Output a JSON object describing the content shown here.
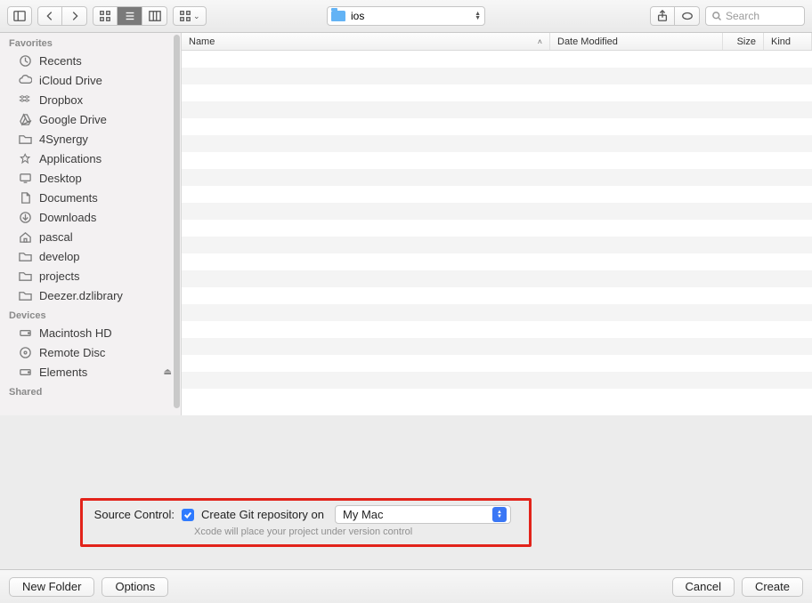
{
  "toolbar": {
    "path_label": "ios",
    "search_placeholder": "Search"
  },
  "sidebar": {
    "sections": [
      {
        "heading": "Favorites",
        "items": [
          "Recents",
          "iCloud Drive",
          "Dropbox",
          "Google Drive",
          "4Synergy",
          "Applications",
          "Desktop",
          "Documents",
          "Downloads",
          "pascal",
          "develop",
          "projects",
          "Deezer.dzlibrary"
        ]
      },
      {
        "heading": "Devices",
        "items": [
          "Macintosh HD",
          "Remote Disc",
          "Elements"
        ]
      },
      {
        "heading": "Shared",
        "items": []
      }
    ]
  },
  "columns": {
    "name": "Name",
    "date": "Date Modified",
    "size": "Size",
    "kind": "Kind"
  },
  "source_control": {
    "label": "Source Control:",
    "checkbox_label": "Create Git repository on",
    "location": "My Mac",
    "hint": "Xcode will place your project under version control"
  },
  "footer": {
    "new_folder": "New Folder",
    "options": "Options",
    "cancel": "Cancel",
    "create": "Create"
  },
  "icons": {
    "sidebar": [
      "clock",
      "cloud",
      "dropbox",
      "gdrive",
      "folder",
      "apps",
      "desktop",
      "docs",
      "downloads",
      "home",
      "folder",
      "folder",
      "folder"
    ],
    "devices": [
      "hdd",
      "disc",
      "hdd"
    ]
  }
}
